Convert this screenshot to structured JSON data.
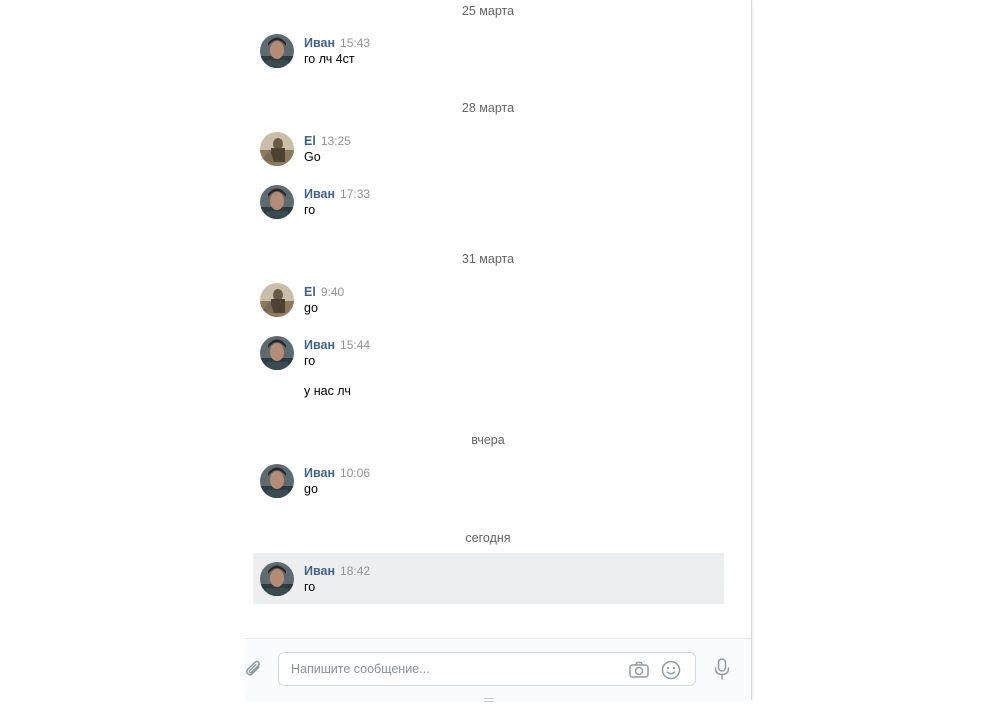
{
  "colors": {
    "author": "#42648b",
    "time": "#939393",
    "date_separator": "#656565",
    "highlight_bg": "#edeef0",
    "panel_border": "#d7d8db"
  },
  "history": {
    "date_separators": [
      "25 марта",
      "28 марта",
      "31 марта",
      "вчера",
      "сегодня"
    ],
    "messages": [
      {
        "author": "Иван",
        "time": "15:43",
        "lines": [
          "го лч 4ст"
        ],
        "avatar": "ivan-avatar"
      },
      {
        "author": "El",
        "time": "13:25",
        "lines": [
          "Go"
        ],
        "avatar": "el-avatar"
      },
      {
        "author": "Иван",
        "time": "17:33",
        "lines": [
          "го"
        ],
        "avatar": "ivan-avatar"
      },
      {
        "author": "El",
        "time": "9:40",
        "lines": [
          "go"
        ],
        "avatar": "el-avatar"
      },
      {
        "author": "Иван",
        "time": "15:44",
        "lines": [
          "го",
          "у нас лч"
        ],
        "avatar": "ivan-avatar"
      },
      {
        "author": "Иван",
        "time": "10:06",
        "lines": [
          "go"
        ],
        "avatar": "ivan-avatar"
      },
      {
        "author": "Иван",
        "time": "18:42",
        "lines": [
          "го"
        ],
        "avatar": "ivan-avatar",
        "highlighted": true
      }
    ]
  },
  "composer": {
    "placeholder": "Напишите сообщение...",
    "value": "",
    "icons": [
      "paperclip-icon",
      "camera-icon",
      "smile-icon",
      "microphone-icon"
    ]
  }
}
